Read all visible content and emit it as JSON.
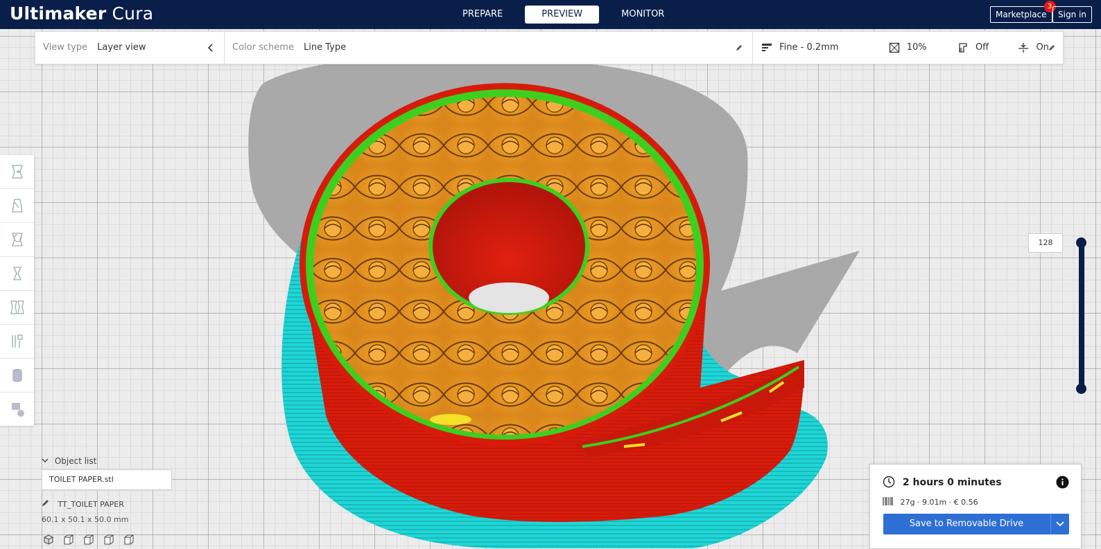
{
  "app": {
    "title_brand": "Ultimaker",
    "title_product": "Cura"
  },
  "stages": [
    {
      "label": "PREPARE",
      "active": false
    },
    {
      "label": "PREVIEW",
      "active": true
    },
    {
      "label": "MONITOR",
      "active": false
    }
  ],
  "header": {
    "marketplace_label": "Marketplace",
    "marketplace_badge": "3",
    "signin_label": "Sign in"
  },
  "view_settings": {
    "view_type_label": "View type",
    "view_type_value": "Layer view",
    "color_scheme_label": "Color scheme",
    "color_scheme_value": "Line Type",
    "profile": "Fine - 0.2mm",
    "infill": "10%",
    "support": "Off",
    "adhesion": "On"
  },
  "tools": [
    "move-tool",
    "scale-tool",
    "rotate-tool",
    "mirror-tool",
    "per-model-settings-tool",
    "support-blocker-tool",
    "cylinder-tool",
    "custom-tool"
  ],
  "object_list": {
    "header": "Object list",
    "file": "TOILET PAPER.stl",
    "machine": "TT_TOILET PAPER",
    "dimensions": "60.1 x 50.1 x 50.0 mm"
  },
  "layer_slider": {
    "current_layer": "128"
  },
  "print_info": {
    "time": "2 hours 0 minutes",
    "material": "27g · 9.01m · € 0.56",
    "save_label": "Save to Removable Drive"
  },
  "colors": {
    "header_bg": "#0a1e4a",
    "wall_red": "#d61b0a",
    "infill_orange": "#e8961c",
    "skin_green": "#3ecf1e",
    "skirt_cyan": "#1fd6d6",
    "shadow_gray": "#a9a9a9",
    "accent_blue": "#2e6fd6"
  }
}
